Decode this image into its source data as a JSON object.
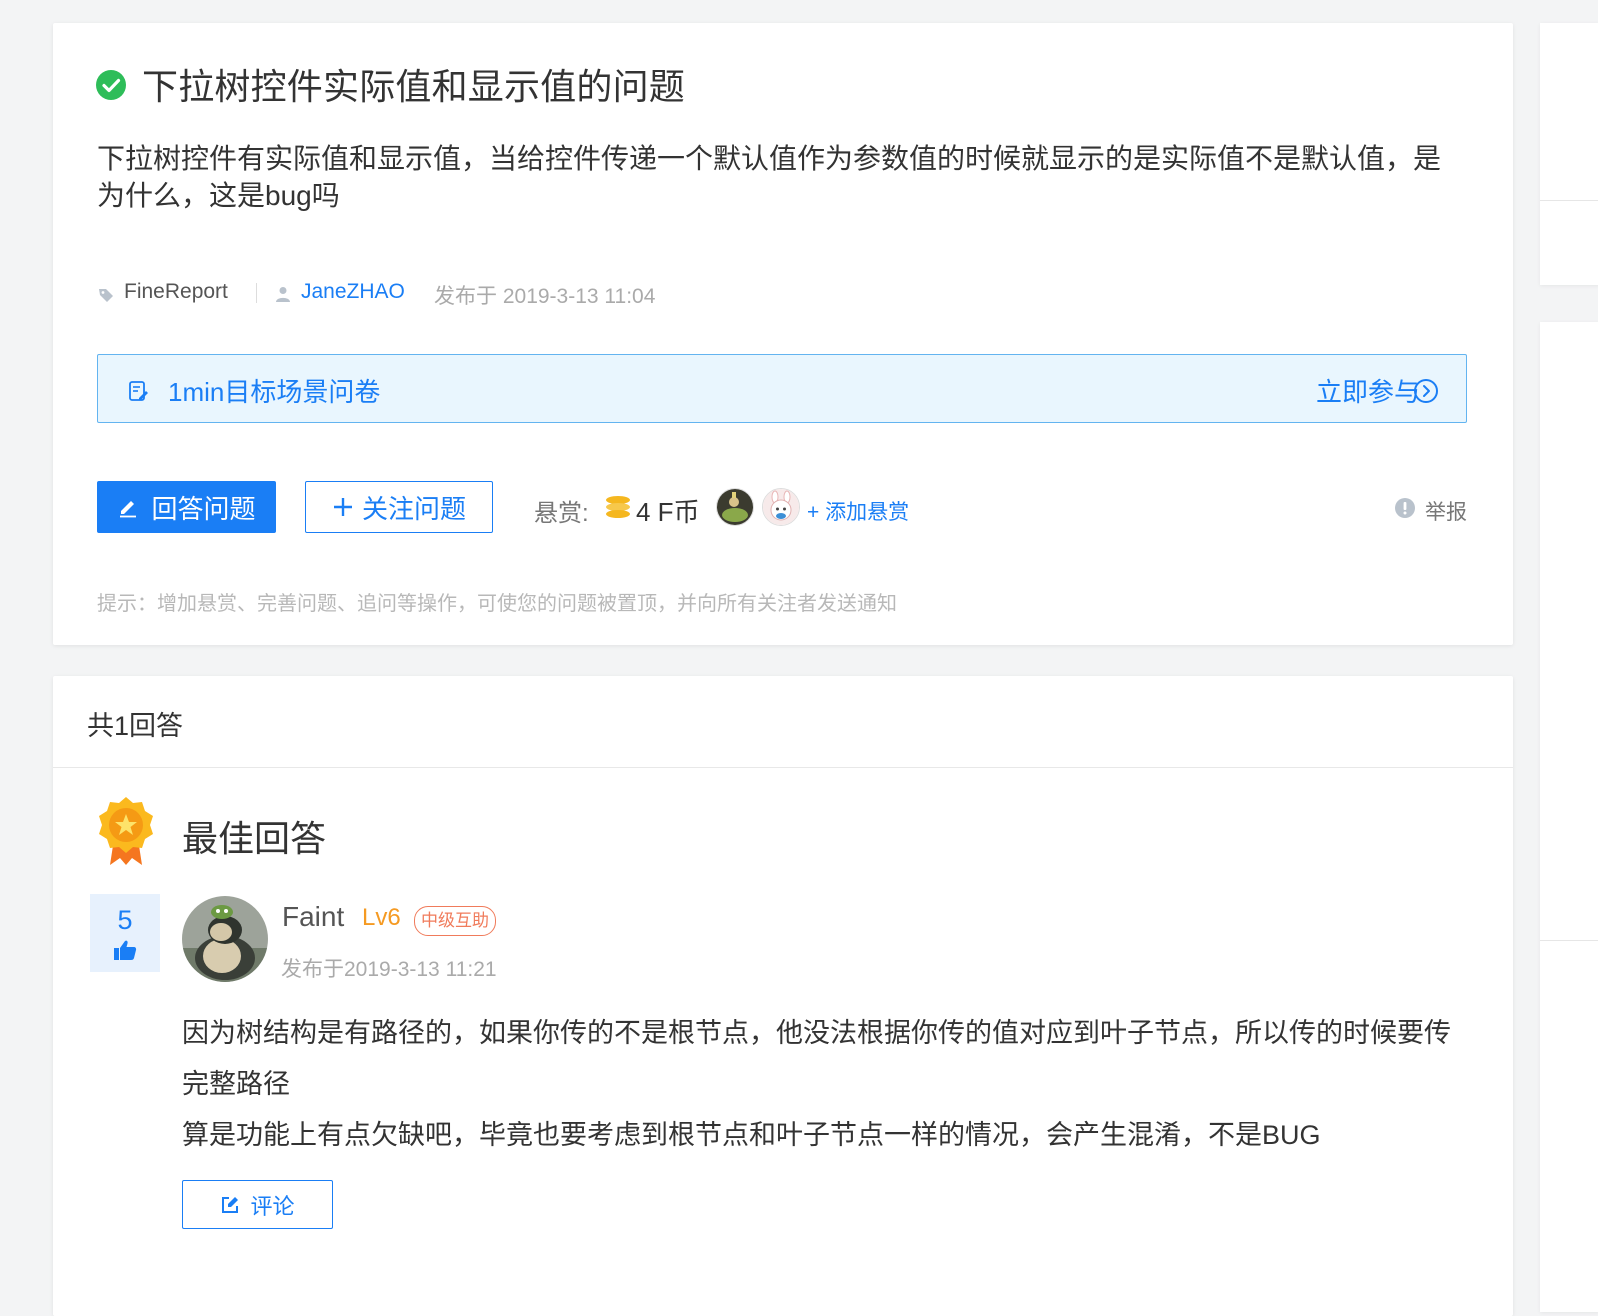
{
  "question": {
    "title": "下拉树控件实际值和显示值的问题",
    "body": "下拉树控件有实际值和显示值，当给控件传递一个默认值作为参数值的时候就显示的是实际值不是默认值，是为什么，这是bug吗",
    "tag": "FineReport",
    "author": "JaneZHAO",
    "date": "发布于 2019-3-13 11:04",
    "status_icon": "check-circle-icon"
  },
  "survey": {
    "text": "1min目标场景问卷",
    "join_label": "立即参与"
  },
  "actions": {
    "answer_label": "回答问题",
    "follow_label": "关注问题",
    "reward_label": "悬赏:",
    "reward_value": "4 F币",
    "add_reward_label": "+ 添加悬赏",
    "report_label": "举报"
  },
  "tip": "提示：增加悬赏、完善问题、追问等操作，可使您的问题被置顶，并向所有关注者发送通知",
  "answers": {
    "count_label": "共1回答",
    "best_label": "最佳回答",
    "items": [
      {
        "votes": "5",
        "user": "Faint",
        "level": "Lv6",
        "badge": "中级互助",
        "date": "发布于2019-3-13 11:21",
        "paragraphs": [
          "因为树结构是有路径的，如果你传的不是根节点，他没法根据你传的值对应到叶子节点，所以传的时候要传完整路径",
          "算是功能上有点欠缺吧，毕竟也要考虑到根节点和叶子节点一样的情况，会产生混淆，不是BUG"
        ],
        "comment_label": "评论"
      }
    ]
  },
  "colors": {
    "accent": "#1a7ef5",
    "success": "#2ebd59",
    "level": "#f59a22",
    "badge": "#f07b5b",
    "survey_bg": "#e9f6fe"
  }
}
